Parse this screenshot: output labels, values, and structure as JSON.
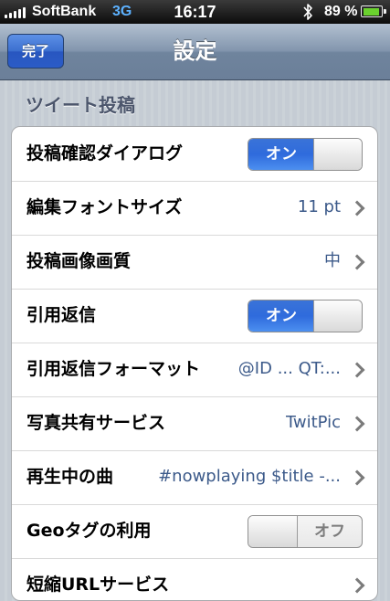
{
  "status_bar": {
    "carrier": "SoftBank",
    "network": "3G",
    "time": "16:17",
    "battery_percent": "89 %",
    "battery_level": 0.89,
    "bluetooth_icon": "bluetooth-icon",
    "signal_icon": "signal-bars-icon"
  },
  "nav_bar": {
    "done_label": "完了",
    "title": "設定"
  },
  "section": {
    "title": "ツイート投稿"
  },
  "rows": [
    {
      "label": "投稿確認ダイアログ",
      "type": "toggle",
      "on": true,
      "on_text": "オン"
    },
    {
      "label": "編集フォントサイズ",
      "type": "value",
      "value": "11 pt"
    },
    {
      "label": "投稿画像画質",
      "type": "value",
      "value": "中"
    },
    {
      "label": "引用返信",
      "type": "toggle",
      "on": true,
      "on_text": "オン"
    },
    {
      "label": "引用返信フォーマット",
      "type": "value",
      "value": "@ID ... QT:..."
    },
    {
      "label": "写真共有サービス",
      "type": "value",
      "value": "TwitPic"
    },
    {
      "label": "再生中の曲",
      "type": "value",
      "value": "#nowplaying $title -..."
    },
    {
      "label": "Geoタグの利用",
      "type": "toggle",
      "on": false,
      "off_text": "オフ"
    },
    {
      "label": "短縮URLサービス",
      "type": "value",
      "value": ""
    }
  ],
  "colors": {
    "toggle_on": "#2f6bdc",
    "value_text": "#3c5a8a",
    "done_button": "#3b6fcf",
    "battery_fill": "#6ad12e"
  }
}
